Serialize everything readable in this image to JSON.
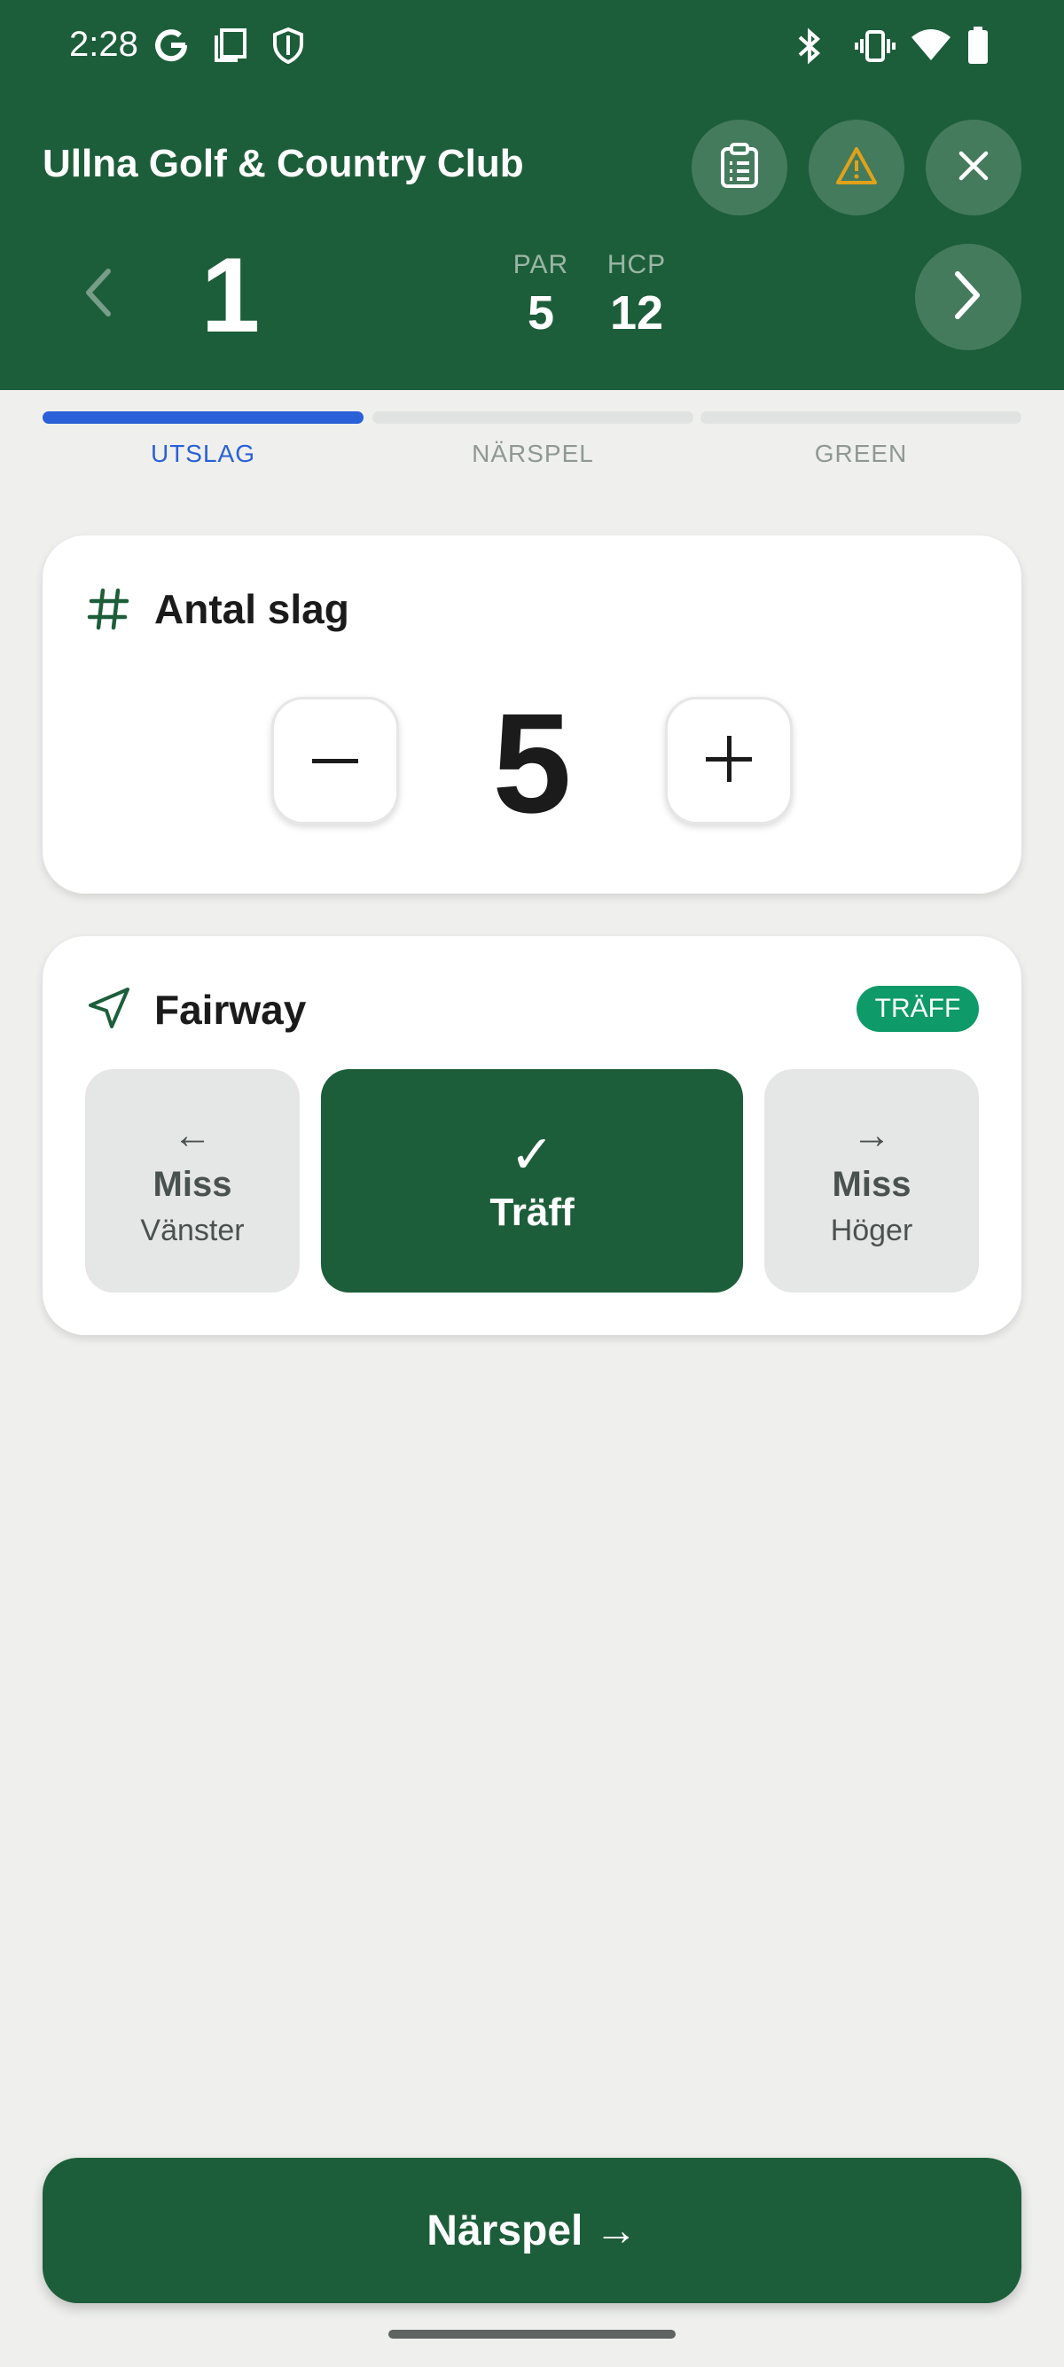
{
  "status_bar": {
    "time": "2:28",
    "left_icons": [
      "google-icon",
      "screenshot-icon",
      "shield-icon"
    ],
    "right_icons": [
      "bluetooth-icon",
      "vibrate-icon",
      "wifi-icon",
      "battery-icon"
    ]
  },
  "header": {
    "title": "Ullna Golf & Country Club",
    "actions": [
      "scorecard-icon",
      "warning-icon",
      "close-icon"
    ],
    "hole_number": "1",
    "par_label": "PAR",
    "par_value": "5",
    "hcp_label": "HCP",
    "hcp_value": "12"
  },
  "steps": {
    "items": [
      {
        "label": "UTSLAG",
        "active": true
      },
      {
        "label": "NÄRSPEL",
        "active": false
      },
      {
        "label": "GREEN",
        "active": false
      }
    ]
  },
  "strokes_card": {
    "icon": "hash-icon",
    "title": "Antal slag",
    "value": "5",
    "decrement_icon": "minus-icon",
    "increment_icon": "plus-icon"
  },
  "fairway_card": {
    "icon": "navigation-icon",
    "title": "Fairway",
    "badge": "TRÄFF",
    "options": {
      "left": {
        "arrow": "←",
        "main": "Miss",
        "sub": "Vänster"
      },
      "hit": {
        "check": "✓",
        "main": "Träff"
      },
      "right": {
        "arrow": "→",
        "main": "Miss",
        "sub": "Höger"
      }
    }
  },
  "footer": {
    "next_label": "Närspel →"
  },
  "colors": {
    "primary": "#1d5e3a",
    "accent_blue": "#2a60d8",
    "badge_green": "#0f9a6a",
    "warning": "#e0a21a",
    "background": "#eff0ee"
  }
}
